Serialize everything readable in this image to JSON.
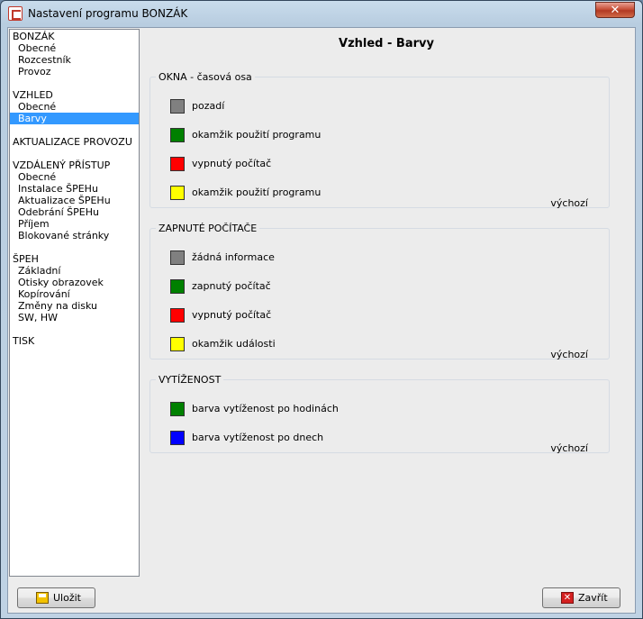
{
  "window": {
    "title": "Nastavení programu BONZÁK",
    "close_glyph": "✕"
  },
  "tree": {
    "items": [
      {
        "label": "BONZÁK",
        "level": 0
      },
      {
        "label": "Obecné",
        "level": 1
      },
      {
        "label": "Rozcestník",
        "level": 1
      },
      {
        "label": "Provoz",
        "level": 1
      },
      {
        "gap": true
      },
      {
        "label": "VZHLED",
        "level": 0
      },
      {
        "label": "Obecné",
        "level": 1
      },
      {
        "label": "Barvy",
        "level": 1,
        "selected": true
      },
      {
        "gap": true
      },
      {
        "label": "AKTUALIZACE PROVOZU",
        "level": 0
      },
      {
        "gap": true
      },
      {
        "label": "VZDÁLENÝ PŘÍSTUP",
        "level": 0
      },
      {
        "label": "Obecné",
        "level": 1
      },
      {
        "label": "Instalace ŠPEHu",
        "level": 1
      },
      {
        "label": "Aktualizace ŠPEHu",
        "level": 1
      },
      {
        "label": "Odebrání ŠPEHu",
        "level": 1
      },
      {
        "label": "Příjem",
        "level": 1
      },
      {
        "label": "Blokované stránky",
        "level": 1
      },
      {
        "gap": true
      },
      {
        "label": "ŠPEH",
        "level": 0
      },
      {
        "label": "Základní",
        "level": 1
      },
      {
        "label": "Otisky obrazovek",
        "level": 1
      },
      {
        "label": "Kopírování",
        "level": 1
      },
      {
        "label": "Změny na disku",
        "level": 1
      },
      {
        "label": "SW, HW",
        "level": 1
      },
      {
        "gap": true
      },
      {
        "label": "TISK",
        "level": 0
      }
    ]
  },
  "page_title": "Vzhled - Barvy",
  "groups": {
    "okna": {
      "legend": "OKNA - časová osa",
      "default_label": "výchozí",
      "rows": [
        {
          "label": "pozadí",
          "color": "#808080"
        },
        {
          "label": "okamžik použití programu",
          "color": "#008000"
        },
        {
          "label": "vypnutý počítač",
          "color": "#ff0000"
        },
        {
          "label": "okamžik použití programu",
          "color": "#ffff00"
        }
      ]
    },
    "zapnute": {
      "legend": "ZAPNUTÉ POČÍTAČE",
      "default_label": "výchozí",
      "rows": [
        {
          "label": "žádná informace",
          "color": "#808080"
        },
        {
          "label": "zapnutý počítač",
          "color": "#008000"
        },
        {
          "label": "vypnutý počítač",
          "color": "#ff0000"
        },
        {
          "label": "okamžik události",
          "color": "#ffff00"
        }
      ]
    },
    "vytizenost": {
      "legend": "VYTÍŽENOST",
      "default_label": "výchozí",
      "rows": [
        {
          "label": "barva vytíženost po hodinách",
          "color": "#008000"
        },
        {
          "label": "barva vytíženost po dnech",
          "color": "#0000ff"
        }
      ]
    }
  },
  "buttons": {
    "save_label": "Uložit",
    "close_label": "Zavřít",
    "close_icon_glyph": "✕"
  }
}
